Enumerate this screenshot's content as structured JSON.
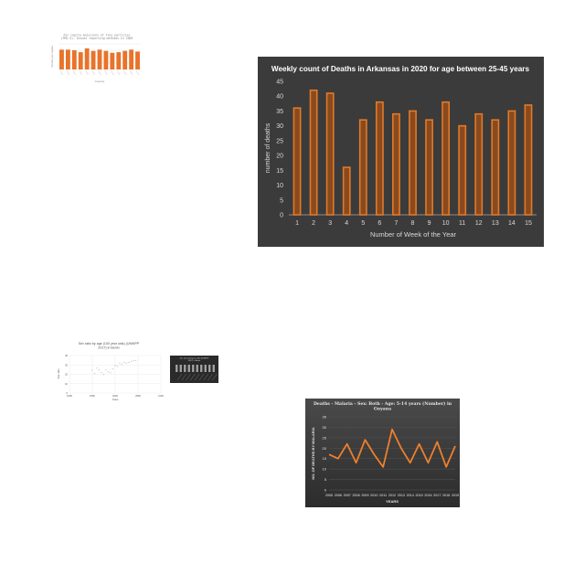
{
  "chart_data": [
    {
      "id": "c1",
      "type": "bar",
      "title": "Per capita emissions of fine particles (PM2.5): Annual reporting methods in 2009",
      "xlabel": "Country",
      "ylabel": "Tonnes per capita",
      "categories": [
        "",
        "",
        "",
        "",
        "",
        "",
        "",
        "",
        "",
        "",
        "",
        "",
        "",
        "",
        ""
      ],
      "values": [
        31,
        31,
        30,
        27,
        33,
        29,
        31,
        29,
        26,
        27,
        29,
        31,
        28
      ],
      "ylim": [
        0,
        40
      ],
      "colors": {
        "bar": "#e8732a",
        "grid": "#e2e2e2",
        "text": "#888888"
      }
    },
    {
      "id": "c2",
      "type": "bar",
      "title": "Weekly count of Deaths in Arkansas in 2020 for age between 25-45 years",
      "xlabel": "Number of Week of the Year",
      "ylabel": "number of deaths",
      "categories": [
        "1",
        "2",
        "3",
        "4",
        "5",
        "6",
        "7",
        "8",
        "9",
        "10",
        "11",
        "12",
        "13",
        "14",
        "15"
      ],
      "values": [
        36,
        42,
        41,
        16,
        32,
        38,
        34,
        35,
        32,
        38,
        30,
        34,
        32,
        35,
        37
      ],
      "ylim": [
        0,
        45
      ],
      "yticks": [
        0,
        5,
        10,
        15,
        20,
        25,
        30,
        35,
        40,
        45
      ],
      "grid": false,
      "colors": {
        "bar": "#e07a2a",
        "bar_inner": "#8a4a1e",
        "background": "#3b3b3b",
        "text": "#d9d9d9",
        "axis": "#8c8c8c"
      }
    },
    {
      "id": "c3",
      "type": "scatter",
      "title": "Sex ratio by age (100 year olds) (UNWPP 2017) in Benin",
      "xlabel": "Years",
      "ylabel": "Sex ratio",
      "x": [
        1950,
        1955,
        1960,
        1965,
        1970,
        1975,
        1980,
        1985,
        1990,
        1995,
        2000,
        2005,
        2010,
        2015,
        2020,
        2025,
        2030,
        2035,
        2040,
        2045
      ],
      "y": [
        25,
        21,
        27,
        25,
        22,
        20,
        25,
        23,
        22,
        26,
        30,
        29,
        32,
        31,
        33,
        32,
        33,
        34,
        35,
        35
      ],
      "xlim": [
        1900,
        2100
      ],
      "xticks": [
        "1900",
        "1950",
        "2000",
        "2050",
        "2100"
      ],
      "ylim": [
        0,
        40
      ],
      "grid": true,
      "colors": {
        "point": "#888888",
        "grid": "#e6e6e6",
        "text": "#555555"
      }
    },
    {
      "id": "c4",
      "type": "bar",
      "title": "Sex ratio (100 year olds) (UNWPP 2017) in Benin",
      "categories": [
        "",
        "",
        "",
        "",
        "",
        "",
        "",
        "",
        "",
        ""
      ],
      "values": [
        0.8,
        0.8,
        0.8,
        0.8,
        0.8,
        0.8,
        0.8,
        0.8,
        0.8,
        0.8
      ],
      "ylim": [
        0,
        1
      ],
      "colors": {
        "bar": "#cfcfcf",
        "background": "#2a2a2a",
        "text": "#dddddd"
      }
    },
    {
      "id": "c5",
      "type": "line",
      "title": "Deaths - Malaria - Sex: Both - Age: 5-14 years (Number) in Guyana",
      "xlabel": "YEARS",
      "ylabel": "NO. OF DEATHS BY MALARIA",
      "categories": [
        "2005",
        "2006",
        "2007",
        "2008",
        "2009",
        "2010",
        "2011",
        "2012",
        "2013",
        "2014",
        "2015",
        "2016",
        "2017",
        "2018",
        "2019"
      ],
      "values": [
        17,
        15,
        22,
        13,
        24,
        17,
        11,
        29,
        20,
        13,
        22,
        13,
        23,
        11,
        21
      ],
      "ylim": [
        0,
        35
      ],
      "yticks": [
        0,
        5,
        10,
        15,
        20,
        25,
        30,
        35
      ],
      "grid": true,
      "colors": {
        "line": "#f07f2c",
        "background": "#3a3a3a",
        "text": "#e6e6e6",
        "grid": "#555555"
      }
    }
  ]
}
